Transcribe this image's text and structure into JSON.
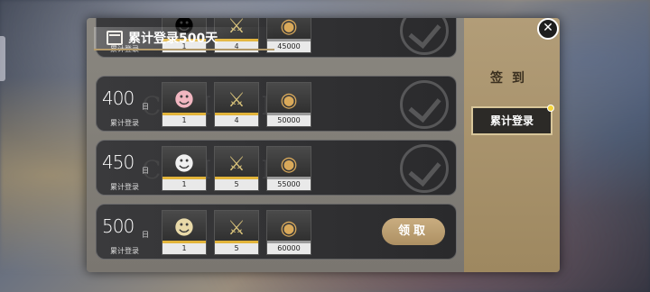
{
  "header": {
    "title": "累计登录500天"
  },
  "side": {
    "title": "签到",
    "button_label": "累计登录"
  },
  "watermark": "CLAIMED",
  "day_unit": "日",
  "day_label": "累计登录",
  "claim_label": "领取",
  "rows": [
    {
      "day": "",
      "claimed": true,
      "rewards": [
        {
          "icon": "character-icon",
          "qty": "1",
          "bar": "gold"
        },
        {
          "icon": "sword-emblem-icon",
          "qty": "4",
          "bar": "gold"
        },
        {
          "icon": "coin-pile-icon",
          "qty": "45000",
          "bar": "grey"
        }
      ]
    },
    {
      "day": "400",
      "claimed": true,
      "rewards": [
        {
          "icon": "character-icon",
          "qty": "1",
          "bar": "gold"
        },
        {
          "icon": "sword-emblem-icon",
          "qty": "4",
          "bar": "gold"
        },
        {
          "icon": "coin-pile-icon",
          "qty": "50000",
          "bar": "grey"
        }
      ]
    },
    {
      "day": "450",
      "claimed": true,
      "rewards": [
        {
          "icon": "character-icon",
          "qty": "1",
          "bar": "gold"
        },
        {
          "icon": "sword-emblem-icon",
          "qty": "5",
          "bar": "gold"
        },
        {
          "icon": "coin-pile-icon",
          "qty": "55000",
          "bar": "grey"
        }
      ]
    },
    {
      "day": "500",
      "claimed": false,
      "rewards": [
        {
          "icon": "character-icon",
          "qty": "1",
          "bar": "gold"
        },
        {
          "icon": "sword-emblem-icon",
          "qty": "5",
          "bar": "gold"
        },
        {
          "icon": "coin-pile-icon",
          "qty": "60000",
          "bar": "grey"
        }
      ]
    }
  ]
}
